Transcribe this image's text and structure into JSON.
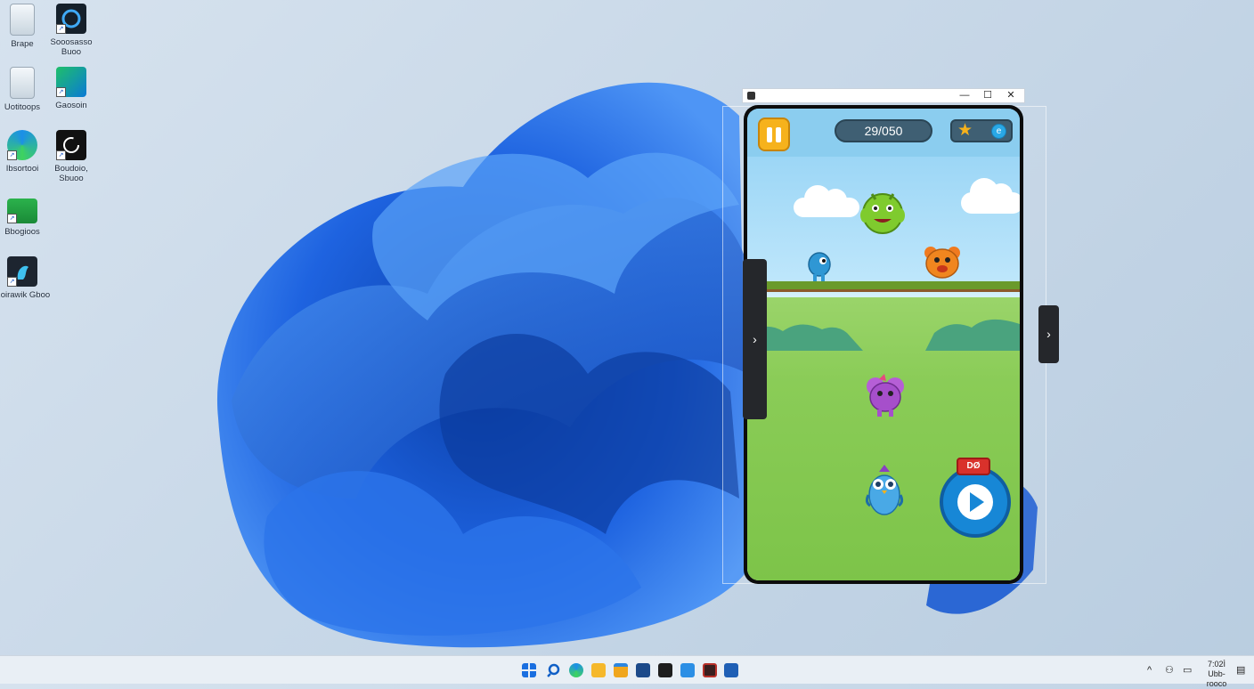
{
  "desktop": {
    "icons": [
      {
        "label": "Brape",
        "icon": "recycle-bin-icon"
      },
      {
        "label": "Sooosasso Buoo",
        "icon": "app-shortcut-icon"
      },
      {
        "label": "Uotitoops",
        "icon": "recycle-bin-full-icon"
      },
      {
        "label": "Gaosoin",
        "icon": "game-shortcut-icon"
      },
      {
        "label": "Ibsortooi",
        "icon": "edge-icon"
      },
      {
        "label": "Boudoio, Sbuoo",
        "icon": "app-shortcut-icon"
      },
      {
        "label": "Bbogioos",
        "icon": "folder-green-icon"
      },
      {
        "label": "Roirawik Gboo",
        "icon": "game-shortcut-icon"
      }
    ]
  },
  "game_window": {
    "titlebar_buttons": [
      "—",
      "☐",
      "✕"
    ],
    "hud": {
      "score": "29/050",
      "pause": "pause-icon",
      "star": "star-icon",
      "coin_glyph": "e"
    },
    "play_badge": "DØ",
    "colors": {
      "sky": "#8fd0f4",
      "grass": "#8acc57",
      "pause_button": "#f6b21c",
      "play_button": "#1787d6",
      "badge": "#d9312b"
    },
    "side_handles": {
      "left": "›",
      "right": "›"
    },
    "characters": [
      "green-monster-icon",
      "blue-blob-icon",
      "orange-bear-icon",
      "purple-creature-icon",
      "blue-owl-icon"
    ]
  },
  "taskbar": {
    "pinned": [
      "windows-start-icon",
      "search-icon",
      "edge-icon",
      "file-explorer-icon",
      "folder-icon",
      "store-icon",
      "terminal-icon",
      "chat-icon",
      "media-icon",
      "settings-icon"
    ],
    "tray": {
      "time": "7:02Ì",
      "date": "Ubb-rooco"
    }
  }
}
